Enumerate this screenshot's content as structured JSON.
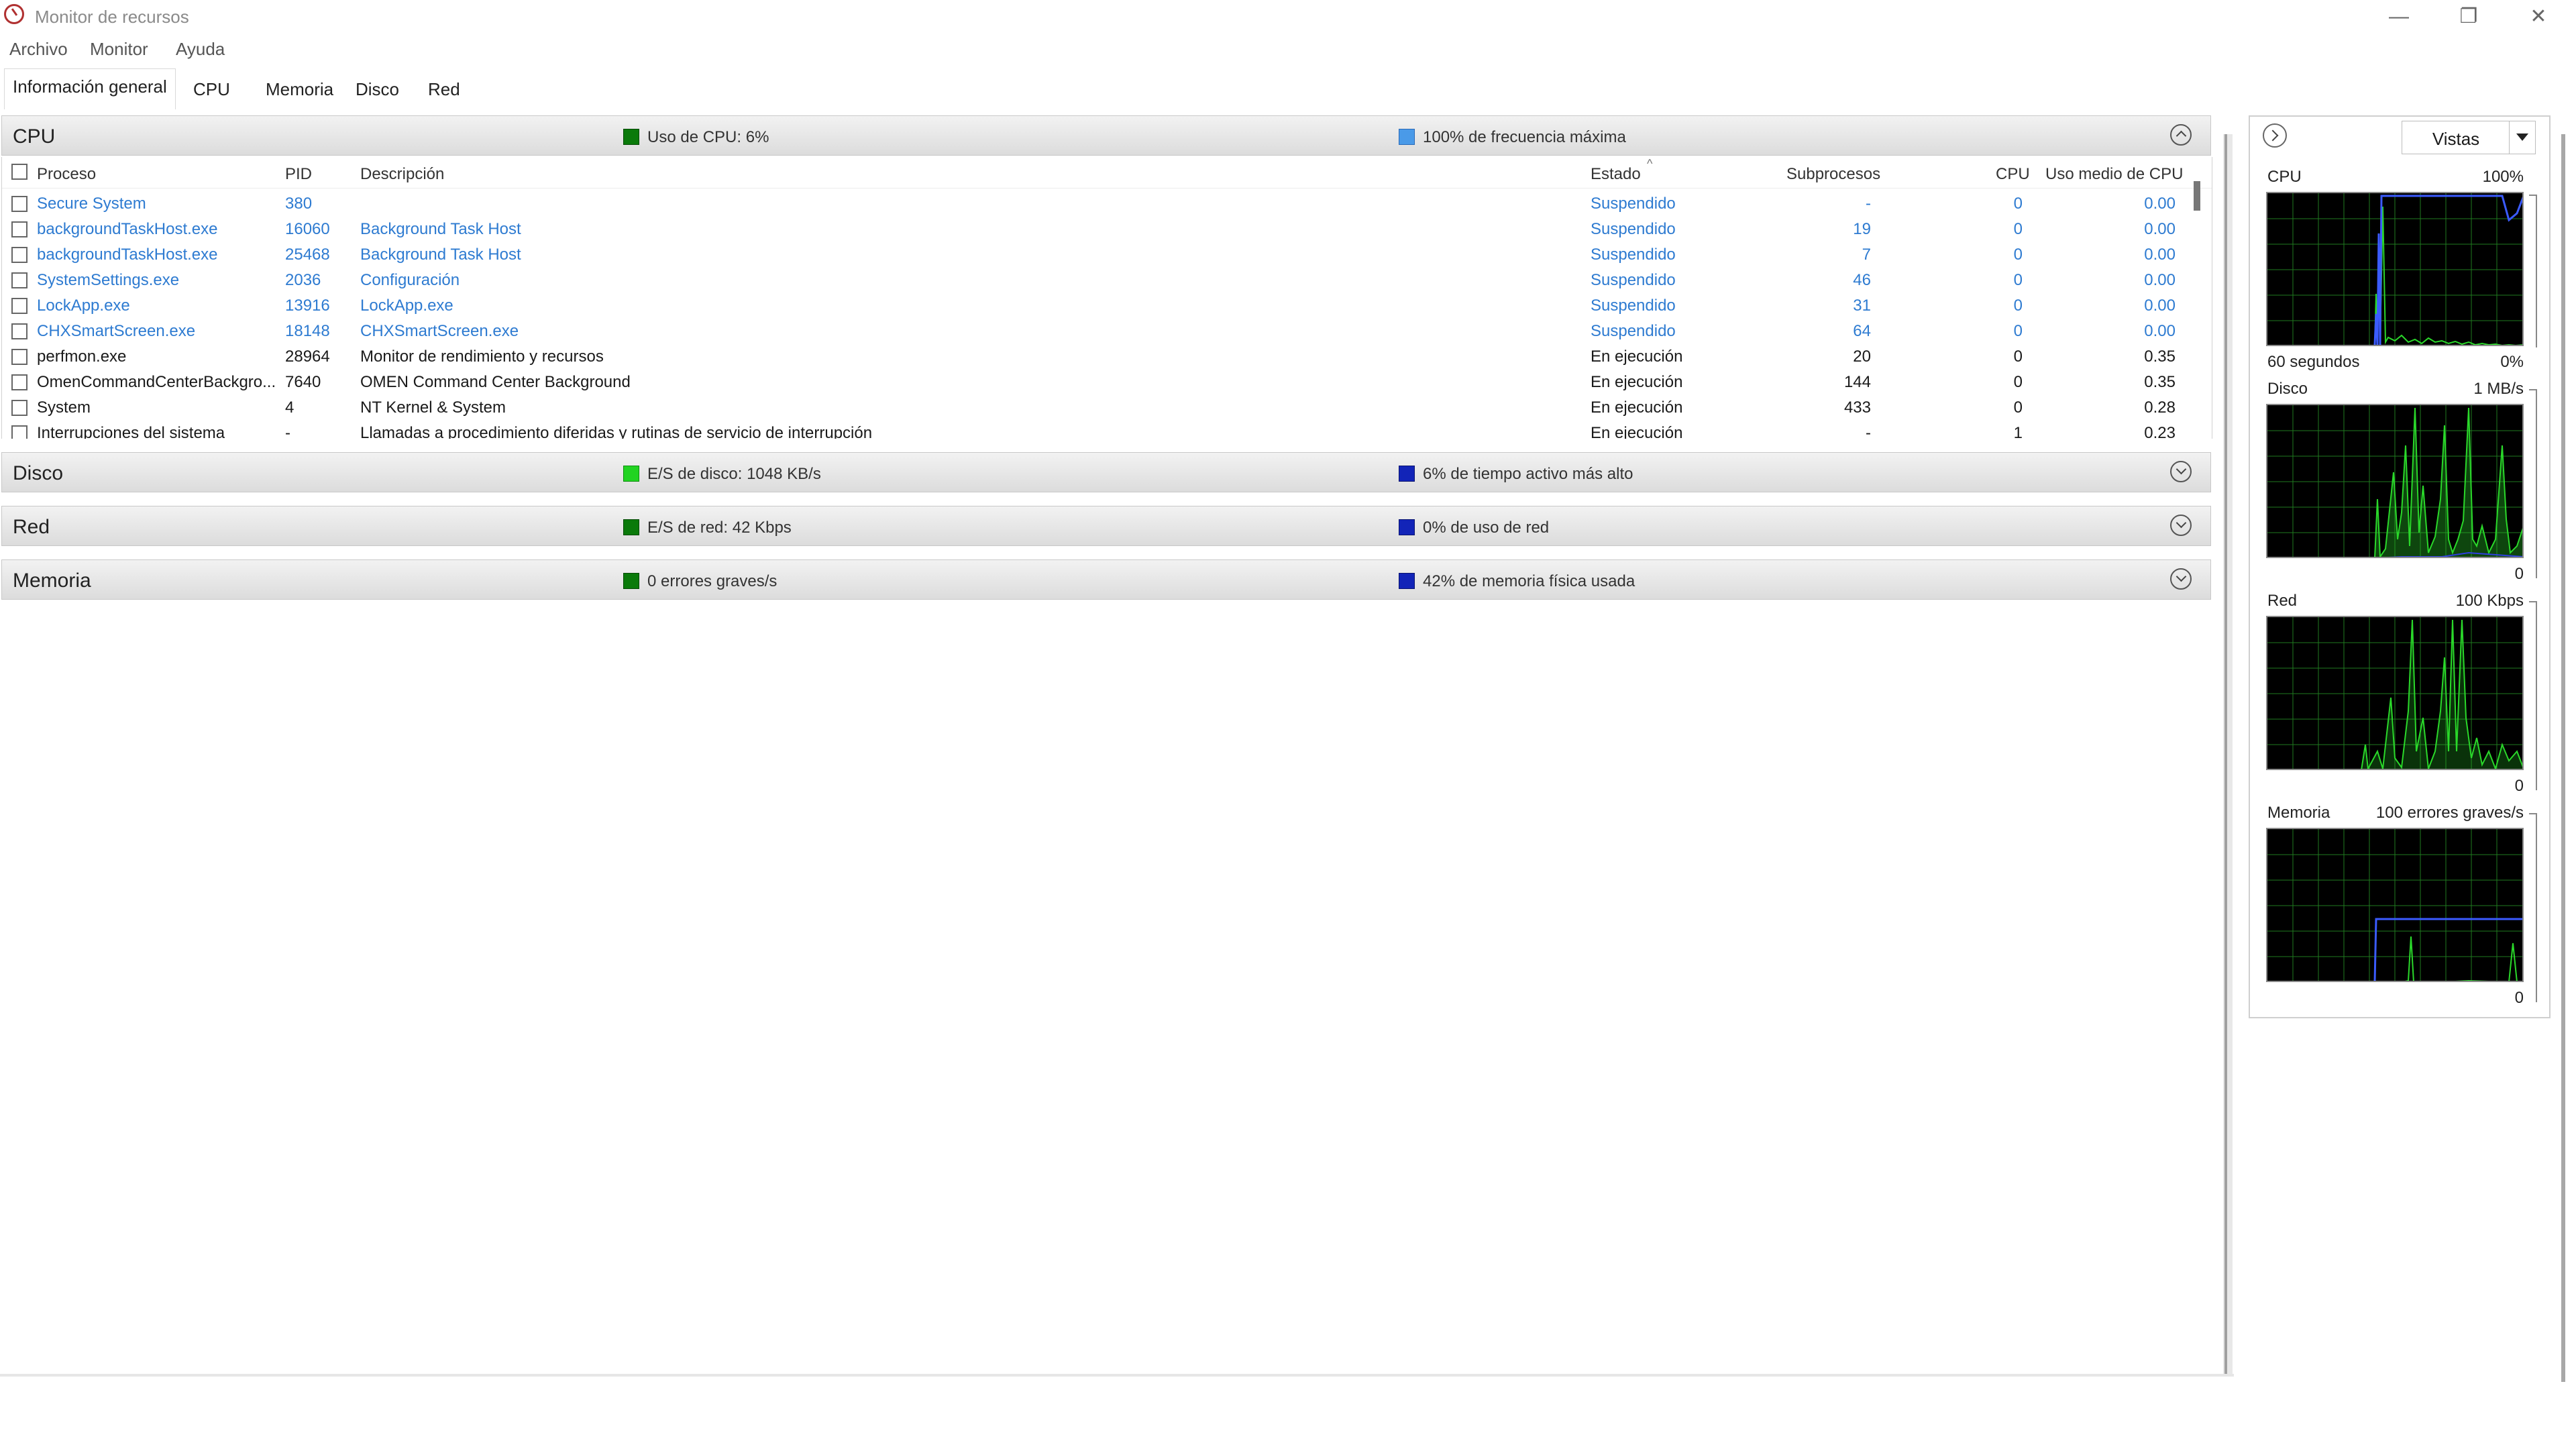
{
  "window": {
    "title": "Monitor de recursos",
    "minimize_glyph": "—",
    "restore_glyph": "❐",
    "close_glyph": "✕"
  },
  "menu": [
    "Archivo",
    "Monitor",
    "Ayuda"
  ],
  "tabs": [
    "Información general",
    "CPU",
    "Memoria",
    "Disco",
    "Red"
  ],
  "sections": {
    "cpu": {
      "title": "CPU",
      "metric1": "Uso de CPU: 6%",
      "metric2": "100% de frecuencia máxima"
    },
    "disk": {
      "title": "Disco",
      "metric1": "E/S de disco: 1048 KB/s",
      "metric2": "6% de tiempo activo más alto"
    },
    "net": {
      "title": "Red",
      "metric1": "E/S de red: 42 Kbps",
      "metric2": "0% de uso de red"
    },
    "memory": {
      "title": "Memoria",
      "metric1": "0 errores graves/s",
      "metric2": "42% de memoria física usada"
    }
  },
  "colors": {
    "green_dark": "#0a7a0a",
    "green_bright": "#22d322",
    "blue_light": "#4a9ae8",
    "blue_dark": "#1224b8",
    "link_blue": "#2e7bd1"
  },
  "table": {
    "headers": {
      "process": "Proceso",
      "pid": "PID",
      "description": "Descripción",
      "status": "Estado",
      "threads": "Subprocesos",
      "cpu": "CPU",
      "avg_cpu": "Uso medio de CPU"
    },
    "rows": [
      {
        "process": "Secure System",
        "pid": "380",
        "description": "",
        "status": "Suspendido",
        "threads": "-",
        "cpu": "0",
        "avg_cpu": "0.00",
        "suspended": true
      },
      {
        "process": "backgroundTaskHost.exe",
        "pid": "16060",
        "description": "Background Task Host",
        "status": "Suspendido",
        "threads": "19",
        "cpu": "0",
        "avg_cpu": "0.00",
        "suspended": true
      },
      {
        "process": "backgroundTaskHost.exe",
        "pid": "25468",
        "description": "Background Task Host",
        "status": "Suspendido",
        "threads": "7",
        "cpu": "0",
        "avg_cpu": "0.00",
        "suspended": true
      },
      {
        "process": "SystemSettings.exe",
        "pid": "2036",
        "description": "Configuración",
        "status": "Suspendido",
        "threads": "46",
        "cpu": "0",
        "avg_cpu": "0.00",
        "suspended": true
      },
      {
        "process": "LockApp.exe",
        "pid": "13916",
        "description": "LockApp.exe",
        "status": "Suspendido",
        "threads": "31",
        "cpu": "0",
        "avg_cpu": "0.00",
        "suspended": true
      },
      {
        "process": "CHXSmartScreen.exe",
        "pid": "18148",
        "description": "CHXSmartScreen.exe",
        "status": "Suspendido",
        "threads": "64",
        "cpu": "0",
        "avg_cpu": "0.00",
        "suspended": true
      },
      {
        "process": "perfmon.exe",
        "pid": "28964",
        "description": "Monitor de rendimiento y recursos",
        "status": "En ejecución",
        "threads": "20",
        "cpu": "0",
        "avg_cpu": "0.35",
        "suspended": false
      },
      {
        "process": "OmenCommandCenterBackgro...",
        "pid": "7640",
        "description": "OMEN Command Center Background",
        "status": "En ejecución",
        "threads": "144",
        "cpu": "0",
        "avg_cpu": "0.35",
        "suspended": false
      },
      {
        "process": "System",
        "pid": "4",
        "description": "NT Kernel & System",
        "status": "En ejecución",
        "threads": "433",
        "cpu": "0",
        "avg_cpu": "0.28",
        "suspended": false
      },
      {
        "process": "Interrupciones del sistema",
        "pid": "-",
        "description": "Llamadas a procedimiento diferidas y rutinas de servicio de interrupción",
        "status": "En ejecución",
        "threads": "-",
        "cpu": "1",
        "avg_cpu": "0.23",
        "suspended": false
      }
    ]
  },
  "right_pane": {
    "views_label": "Vistas",
    "graphs": {
      "cpu": {
        "label": "CPU",
        "max": "100%",
        "footer_left": "60 segundos",
        "footer_right": "0%"
      },
      "disk": {
        "label": "Disco",
        "max": "1 MB/s",
        "footer_left": "",
        "footer_right": "0"
      },
      "net": {
        "label": "Red",
        "max": "100 Kbps",
        "footer_left": "",
        "footer_right": "0"
      },
      "memory": {
        "label": "Memoria",
        "max": "100 errores graves/s",
        "footer_left": "",
        "footer_right": "0"
      }
    }
  }
}
